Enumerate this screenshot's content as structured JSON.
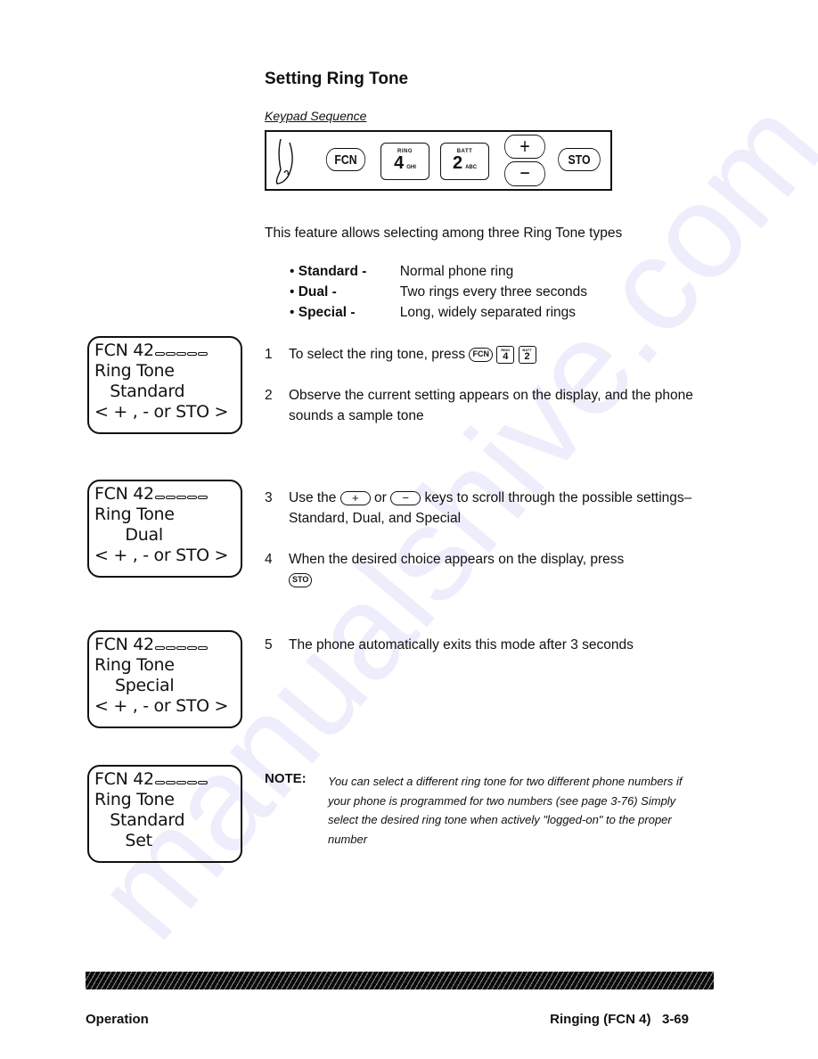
{
  "watermark": "manualshive.com",
  "section": {
    "title": "Setting Ring Tone",
    "keypad_label": "Keypad Sequence",
    "keypad_sequence": [
      {
        "type": "pill",
        "label": "FCN"
      },
      {
        "type": "key",
        "top": "RING",
        "num": "4",
        "sub": "GHI"
      },
      {
        "type": "key",
        "top": "BATT",
        "num": "2",
        "sub": "ABC"
      },
      {
        "type": "pill",
        "label": "+"
      },
      {
        "type": "pill",
        "label": "−"
      },
      {
        "type": "pill",
        "label": "STO"
      }
    ]
  },
  "intro": "This feature allows selecting among three Ring Tone types",
  "features": [
    {
      "name": "Standard -",
      "desc": "Normal phone ring"
    },
    {
      "name": "Dual -",
      "desc": "Two rings every three seconds"
    },
    {
      "name": "Special -",
      "desc": "Long, widely separated rings"
    }
  ],
  "steps": [
    {
      "n": "1",
      "before": "To select the ring tone, press",
      "after": ""
    },
    {
      "n": "2",
      "before": "Observe the current setting appears on the display, and the phone sounds a sample tone",
      "after": ""
    },
    {
      "n": "3",
      "before": "Use the",
      "mid": "or",
      "after": "keys to scroll through the possible settings–Standard, Dual, and Special"
    },
    {
      "n": "4",
      "before": "When the desired choice appears on the display, press",
      "after": ""
    },
    {
      "n": "5",
      "before": "The phone automatically exits this mode after 3 seconds",
      "after": ""
    }
  ],
  "inline_keys": {
    "fcn": "FCN",
    "ring_top": "RING",
    "ring_num": "4",
    "batt_top": "BATT",
    "batt_num": "2",
    "plus": "+",
    "minus": "−",
    "sto": "STO"
  },
  "displays": [
    {
      "line1": "FCN 42",
      "line2": "Ring Tone",
      "line3": "   Standard",
      "line4": "< + , - or STO >"
    },
    {
      "line1": "FCN 42",
      "line2": "Ring Tone",
      "line3": "      Dual",
      "line4": "< + , - or STO >"
    },
    {
      "line1": "FCN 42",
      "line2": "Ring Tone",
      "line3": "    Special",
      "line4": "< + , - or STO >"
    },
    {
      "line1": "FCN 42",
      "line2": "Ring Tone",
      "line3": "   Standard",
      "line4": "      Set"
    }
  ],
  "note": {
    "label": "NOTE:",
    "text": "You can select a different ring tone for two different phone numbers if your phone is programmed for two numbers (see page 3-76)   Simply select the desired ring tone when actively \"logged-on\" to the proper number"
  },
  "footer": {
    "left": "Operation",
    "right": "Ringing (FCN 4)   3-69"
  }
}
